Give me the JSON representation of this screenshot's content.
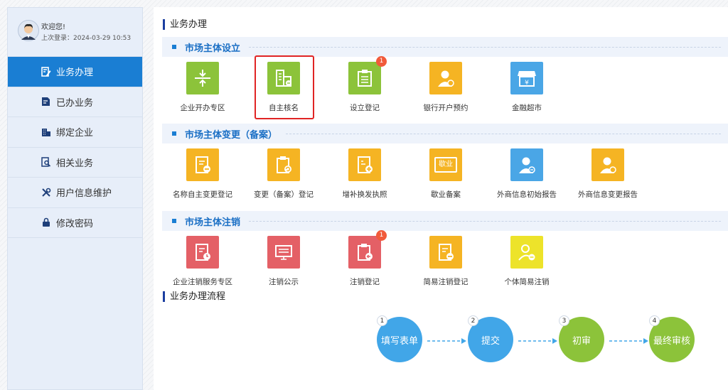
{
  "user": {
    "welcome": "欢迎您!",
    "last_login": "上次登录：2024-03-29 10:53"
  },
  "nav": [
    {
      "label": "业务办理",
      "icon": "edit-doc-icon",
      "active": true
    },
    {
      "label": "已办业务",
      "icon": "done-doc-icon",
      "active": false
    },
    {
      "label": "绑定企业",
      "icon": "building-icon",
      "active": false
    },
    {
      "label": "相关业务",
      "icon": "search-doc-icon",
      "active": false
    },
    {
      "label": "用户信息维护",
      "icon": "tools-icon",
      "active": false
    },
    {
      "label": "修改密码",
      "icon": "lock-icon",
      "active": false
    }
  ],
  "main": {
    "title": "业务办理",
    "sections": [
      {
        "title": "市场主体设立",
        "items": [
          {
            "label": "企业开办专区",
            "color": "#8cc33a",
            "icon": "compress-icon"
          },
          {
            "label": "自主核名",
            "color": "#8cc33a",
            "icon": "building-name-icon"
          },
          {
            "label": "设立登记",
            "color": "#8cc33a",
            "icon": "clipboard-icon",
            "badge": "1"
          },
          {
            "label": "银行开户预约",
            "color": "#f5b423",
            "icon": "bank-person-icon"
          },
          {
            "label": "金融超市",
            "color": "#4aa6e6",
            "icon": "shop-icon"
          }
        ]
      },
      {
        "title": "市场主体变更（备案）",
        "items": [
          {
            "label": "名称自主变更登记",
            "color": "#f5b423",
            "icon": "doc-minus-icon"
          },
          {
            "label": "变更（备案）登记",
            "color": "#f5b423",
            "icon": "clipboard-refresh-icon"
          },
          {
            "label": "增补换发执照",
            "color": "#f5b423",
            "icon": "doc-plus-icon"
          },
          {
            "label": "歇业备案",
            "color": "#f5b423",
            "icon": "pause-business-icon",
            "inner": "歇业"
          },
          {
            "label": "外商信息初始报告",
            "color": "#4aa6e6",
            "icon": "person-doc-icon"
          },
          {
            "label": "外商信息变更报告",
            "color": "#f5b423",
            "icon": "person-refresh-icon"
          }
        ]
      },
      {
        "title": "市场主体注销",
        "items": [
          {
            "label": "企业注销服务专区",
            "color": "#e46066",
            "icon": "doc-clock-icon"
          },
          {
            "label": "注销公示",
            "color": "#e46066",
            "icon": "notice-icon"
          },
          {
            "label": "注销登记",
            "color": "#e46066",
            "icon": "clipboard-back-icon",
            "badge": "1"
          },
          {
            "label": "简易注销登记",
            "color": "#f5b423",
            "icon": "doc-minus-icon"
          },
          {
            "label": "个体简易注销",
            "color": "#ede32a",
            "icon": "person-minus-icon"
          }
        ]
      }
    ],
    "flow_title": "业务办理流程",
    "flow": [
      {
        "num": "1",
        "label": "填写表单"
      },
      {
        "num": "2",
        "label": "提交"
      },
      {
        "num": "3",
        "label": "初审"
      },
      {
        "num": "4",
        "label": "最终审核"
      }
    ]
  }
}
